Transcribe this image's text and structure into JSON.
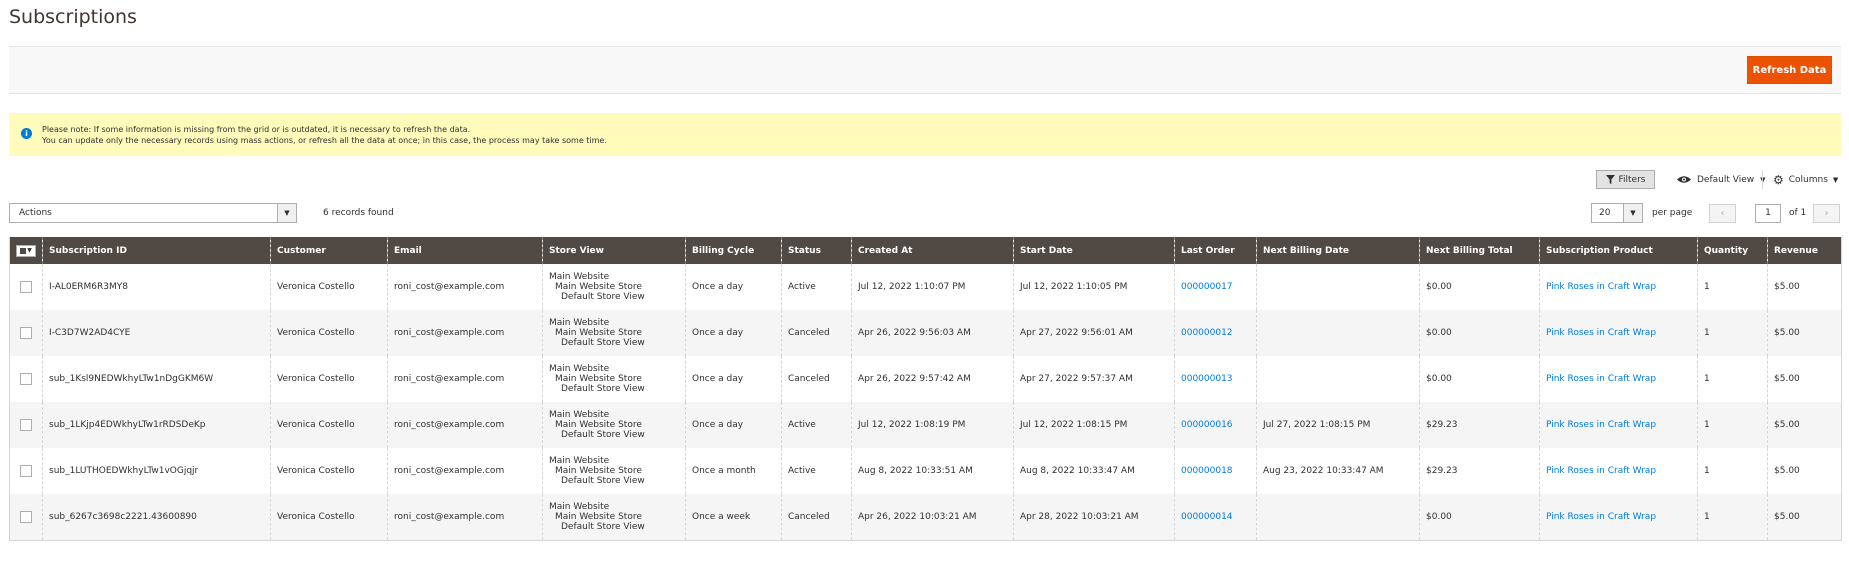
{
  "page": {
    "title": "Subscriptions"
  },
  "toolbar": {
    "refresh_label": "Refresh Data"
  },
  "notice": {
    "line1": "Please note: If some information is missing from the grid or is outdated, it is necessary to refresh the data.",
    "line2": "You can update only the necessary records using mass actions, or refresh all the data at once; in this case, the process may take some time."
  },
  "controls": {
    "filters_label": "Filters",
    "view_label": "Default View",
    "columns_label": "Columns",
    "actions_value": "Actions",
    "records_found": "6 records found",
    "per_page_value": "20",
    "per_page_label": "per page",
    "current_page": "1",
    "total_pages_label": "of 1"
  },
  "grid": {
    "headers": [
      "Subscription ID",
      "Customer",
      "Email",
      "Store View",
      "Billing Cycle",
      "Status",
      "Created At",
      "Start Date",
      "Last Order",
      "Next Billing Date",
      "Next Billing Total",
      "Subscription Product",
      "Quantity",
      "Revenue"
    ],
    "rows": [
      {
        "id": "I-AL0ERM6R3MY8",
        "customer": "Veronica Costello",
        "email": "roni_cost@example.com",
        "store1": "Main Website",
        "store2": "Main Website Store",
        "store3": "Default Store View",
        "cycle": "Once a day",
        "status": "Active",
        "created": "Jul 12, 2022 1:10:07 PM",
        "start": "Jul 12, 2022 1:10:05 PM",
        "last_order": "000000017",
        "next_date": "",
        "next_total": "$0.00",
        "product": "Pink Roses in Craft Wrap",
        "qty": "1",
        "revenue": "$5.00"
      },
      {
        "id": "I-C3D7W2AD4CYE",
        "customer": "Veronica Costello",
        "email": "roni_cost@example.com",
        "store1": "Main Website",
        "store2": "Main Website Store",
        "store3": "Default Store View",
        "cycle": "Once a day",
        "status": "Canceled",
        "created": "Apr 26, 2022 9:56:03 AM",
        "start": "Apr 27, 2022 9:56:01 AM",
        "last_order": "000000012",
        "next_date": "",
        "next_total": "$0.00",
        "product": "Pink Roses in Craft Wrap",
        "qty": "1",
        "revenue": "$5.00"
      },
      {
        "id": "sub_1Ksl9NEDWkhyLTw1nDgGKM6W",
        "customer": "Veronica Costello",
        "email": "roni_cost@example.com",
        "store1": "Main Website",
        "store2": "Main Website Store",
        "store3": "Default Store View",
        "cycle": "Once a day",
        "status": "Canceled",
        "created": "Apr 26, 2022 9:57:42 AM",
        "start": "Apr 27, 2022 9:57:37 AM",
        "last_order": "000000013",
        "next_date": "",
        "next_total": "$0.00",
        "product": "Pink Roses in Craft Wrap",
        "qty": "1",
        "revenue": "$5.00"
      },
      {
        "id": "sub_1LKjp4EDWkhyLTw1rRDSDeKp",
        "customer": "Veronica Costello",
        "email": "roni_cost@example.com",
        "store1": "Main Website",
        "store2": "Main Website Store",
        "store3": "Default Store View",
        "cycle": "Once a day",
        "status": "Active",
        "created": "Jul 12, 2022 1:08:19 PM",
        "start": "Jul 12, 2022 1:08:15 PM",
        "last_order": "000000016",
        "next_date": "Jul 27, 2022 1:08:15 PM",
        "next_total": "$29.23",
        "product": "Pink Roses in Craft Wrap",
        "qty": "1",
        "revenue": "$5.00"
      },
      {
        "id": "sub_1LUTHOEDWkhyLTw1vOGjqjr",
        "customer": "Veronica Costello",
        "email": "roni_cost@example.com",
        "store1": "Main Website",
        "store2": "Main Website Store",
        "store3": "Default Store View",
        "cycle": "Once a month",
        "status": "Active",
        "created": "Aug 8, 2022 10:33:51 AM",
        "start": "Aug 8, 2022 10:33:47 AM",
        "last_order": "000000018",
        "next_date": "Aug 23, 2022 10:33:47 AM",
        "next_total": "$29.23",
        "product": "Pink Roses in Craft Wrap",
        "qty": "1",
        "revenue": "$5.00"
      },
      {
        "id": "sub_6267c3698c2221.43600890",
        "customer": "Veronica Costello",
        "email": "roni_cost@example.com",
        "store1": "Main Website",
        "store2": "Main Website Store",
        "store3": "Default Store View",
        "cycle": "Once a week",
        "status": "Canceled",
        "created": "Apr 26, 2022 10:03:21 AM",
        "start": "Apr 28, 2022 10:03:21 AM",
        "last_order": "000000014",
        "next_date": "",
        "next_total": "$0.00",
        "product": "Pink Roses in Craft Wrap",
        "qty": "1",
        "revenue": "$5.00"
      }
    ]
  },
  "icons": {
    "info": "info-icon",
    "filter": "filter-icon",
    "eye": "eye-icon",
    "gear": "gear-icon",
    "prev": "chevron-left-icon",
    "next": "chevron-right-icon"
  },
  "colors": {
    "accent": "#eb5202",
    "header_bg": "#514943",
    "notice_bg": "#fffbbb",
    "link": "#007bdb"
  }
}
